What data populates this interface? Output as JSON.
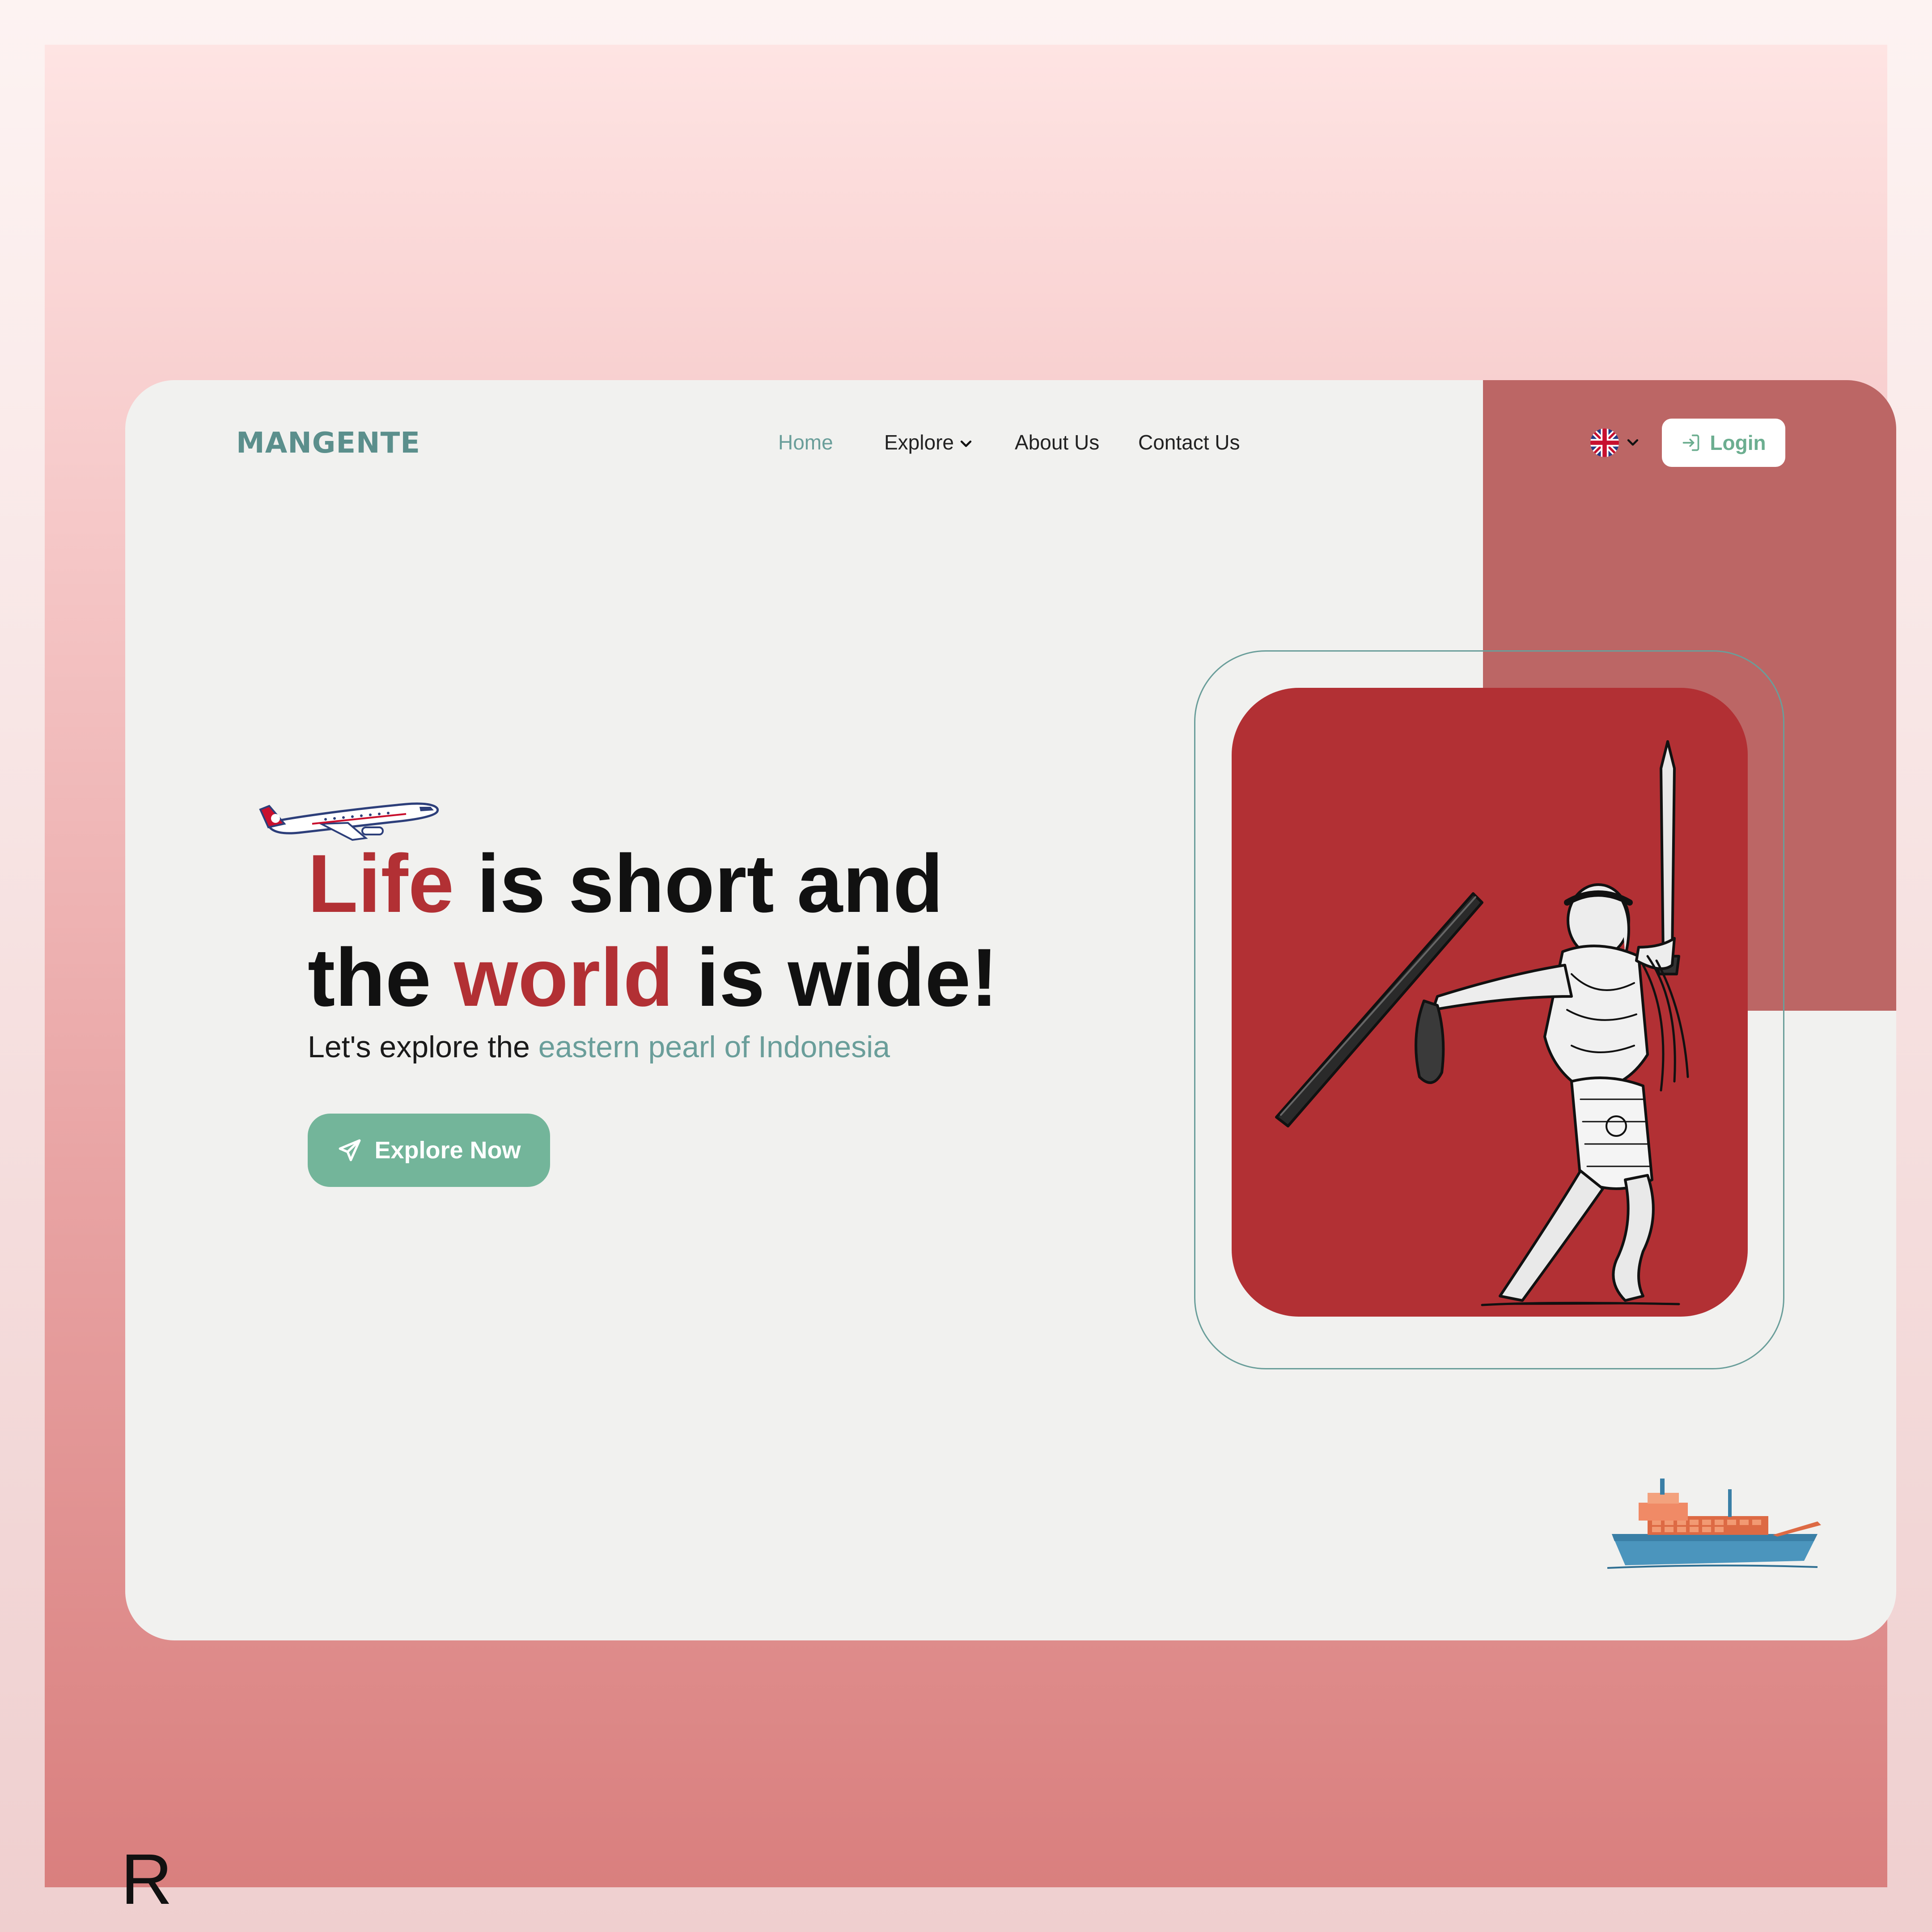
{
  "brand": {
    "name": "MANGENTE"
  },
  "nav": {
    "items": [
      {
        "label": "Home",
        "active": true
      },
      {
        "label": "Explore",
        "has_dropdown": true
      },
      {
        "label": "About Us"
      },
      {
        "label": "Contact Us"
      }
    ]
  },
  "language": {
    "icon": "uk-flag-icon",
    "dropdown_icon": "chevron-down-icon"
  },
  "login": {
    "label": "Login",
    "icon": "login-icon"
  },
  "hero": {
    "headline_part1": "Life",
    "headline_part2": " is short and the ",
    "headline_part3": "world",
    "headline_part4": " is wide!",
    "subtitle_plain": "Let's explore the ",
    "subtitle_accent": "eastern pearl of Indonesia",
    "cta_label": "Explore Now",
    "cta_icon": "paper-plane-icon"
  },
  "illustrations": {
    "plane": "airplane-illustration",
    "warrior": "cakalele-warrior-illustration",
    "ship": "cargo-ship-illustration"
  },
  "corner_mark": "R",
  "colors": {
    "accent_red": "#b23034",
    "teal": "#6a9e9a",
    "green_button": "#73b59a",
    "side_panel": "#bc6665",
    "card_bg": "#f1f1ef"
  }
}
